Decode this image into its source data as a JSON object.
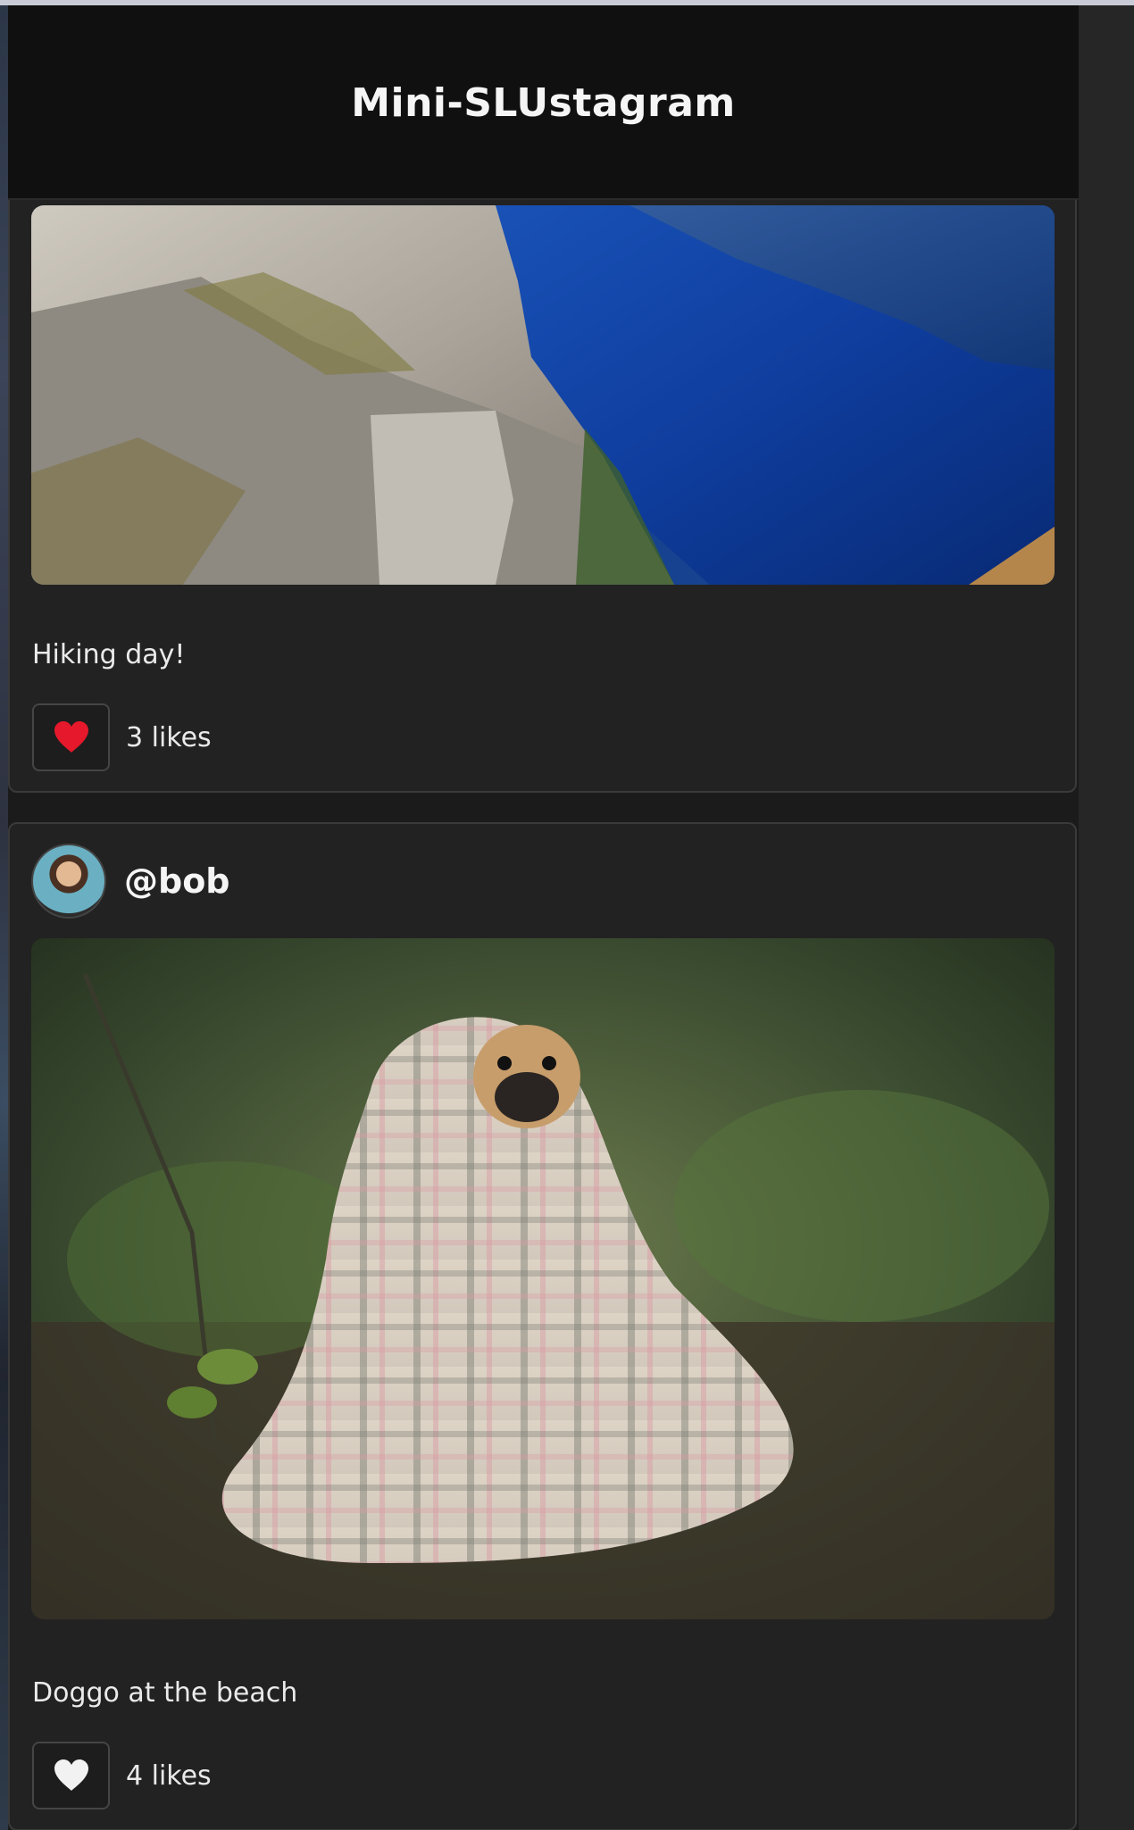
{
  "app": {
    "title": "Mini-SLUstagram"
  },
  "posts": [
    {
      "username": "",
      "caption": "Hiking day!",
      "likes_text": "3 likes",
      "liked": true,
      "like_icon": "heart-filled-icon",
      "heart_color": "#e5192b"
    },
    {
      "username": "@bob",
      "caption": "Doggo at the beach",
      "likes_text": "4 likes",
      "liked": false,
      "like_icon": "heart-outline-icon",
      "heart_color": "#f2f2f2"
    }
  ]
}
